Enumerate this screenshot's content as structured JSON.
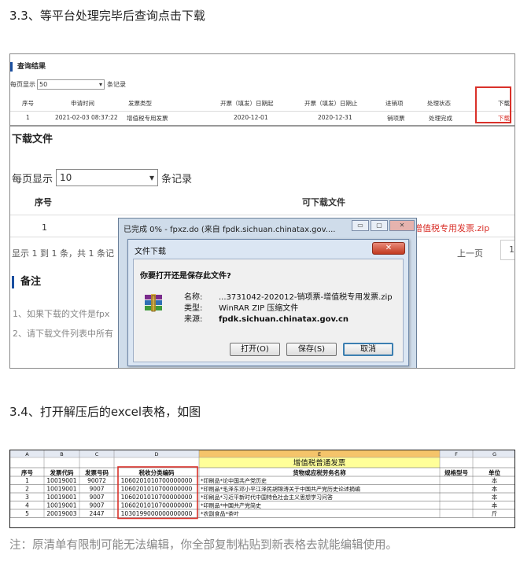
{
  "headings": {
    "step1": "3.3、等平台处理完毕后查询点击下载",
    "step2": "3.4、打开解压后的excel表格，如图"
  },
  "query_result": {
    "title": "查询结果",
    "per_page_prefix": "每页显示",
    "per_page_value": "50",
    "per_page_suffix": "条记录",
    "columns": [
      "序号",
      "申请时间",
      "发票类型",
      "开票（填发）日期起",
      "开票（填发）日期止",
      "进销项",
      "处理状态",
      "下载"
    ],
    "row": [
      "1",
      "2021-02-03 08:37:22",
      "增值税专用发票",
      "2020-12-01",
      "2020-12-31",
      "销项票",
      "处理完成",
      "下载"
    ]
  },
  "download_panel": {
    "title": "下载文件",
    "per_page_prefix": "每页显示",
    "per_page_value": "10",
    "per_page_suffix": "条记录",
    "col_no": "序号",
    "col_file": "可下载文件",
    "row_no": "1",
    "file_link": "-增值税专用发票.zip",
    "status": "显示 1 到 1 条，共 1 条记",
    "prev": "上一页",
    "page": "1",
    "notes_title": "备注",
    "note1": "1、如果下载的文件是fpx",
    "note2": "2、请下载文件列表中所有"
  },
  "ie_window": {
    "title": "已完成 0% - fpxz.do (来自 fpdk.sichuan.chinatax.gov....",
    "btn_min": "▭",
    "btn_max": "▢",
    "btn_close": "✕"
  },
  "file_dialog": {
    "title": "文件下载",
    "close": "✕",
    "question": "你要打开还是保存此文件?",
    "label_name": "名称:",
    "label_type": "类型:",
    "label_from": "来源:",
    "name": "...3731042-202012-销项票-增值税专用发票.zip",
    "type": "WinRAR ZIP 压缩文件",
    "from": "fpdk.sichuan.chinatax.gov.cn",
    "btn_open": "打开(O)",
    "btn_save": "保存(S)",
    "btn_cancel": "取消",
    "icon": "winrar-archive-icon"
  },
  "excel": {
    "col_letters": [
      "A",
      "B",
      "C",
      "D",
      "E",
      "F",
      "G"
    ],
    "title": "增值税普通发票",
    "headers": [
      "序号",
      "发票代码",
      "发票号码",
      "税收分类编码",
      "货物或应税劳务名称",
      "规格型号",
      "单位"
    ],
    "rows": [
      [
        "1",
        "10019001",
        "90072",
        "1060201010700000000",
        "*印刷品*论中国共产党历史",
        "",
        "本"
      ],
      [
        "2",
        "10019001",
        "9007",
        "1060201010700000000",
        "*印刷品*毛泽东邓小平江泽民胡锦涛关于中国共产党历史论述摘编",
        "",
        "本"
      ],
      [
        "3",
        "10019001",
        "9007",
        "1060201010700000000",
        "*印刷品*习近平新时代中国特色社会主义思想学习问答",
        "",
        "本"
      ],
      [
        "4",
        "10019001",
        "9007",
        "1060201010700000000",
        "*印刷品*中国共产党简史",
        "",
        "本"
      ],
      [
        "5",
        "20019003",
        "2447",
        "1030199000000000000",
        "*农副食品*茶叶",
        "",
        "斤"
      ]
    ]
  },
  "footer_note": "注：原清单有限制可能无法编辑，你全部复制粘贴到新表格去就能编辑使用。",
  "colors": {
    "accent_red": "#d9312a",
    "brand_blue": "#1a4fa0",
    "excel_title_fill": "#ffff99"
  }
}
